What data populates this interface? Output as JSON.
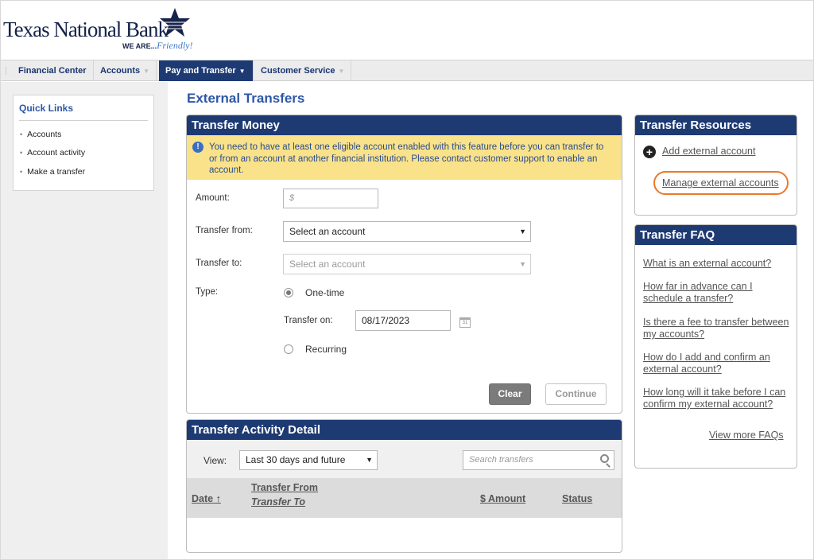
{
  "brand": {
    "name": "Texas National Bank",
    "tagline_part1": "WE ARE...",
    "tagline_part2": "Friendly!"
  },
  "nav": {
    "items": [
      {
        "label": "Financial Center"
      },
      {
        "label": "Accounts"
      },
      {
        "label": "Pay and Transfer"
      },
      {
        "label": "Customer Service"
      }
    ],
    "active": "Pay and Transfer"
  },
  "quick_links": {
    "title": "Quick Links",
    "items": [
      "Accounts",
      "Account activity",
      "Make a transfer"
    ]
  },
  "page": {
    "title": "External Transfers"
  },
  "transfer_money": {
    "title": "Transfer Money",
    "alert": "You need to have at least one eligible account enabled with this feature before you can transfer to or from an account at another financial institution. Please contact customer support to enable an account.",
    "amount_label": "Amount:",
    "amount_placeholder": "$",
    "from_label": "Transfer from:",
    "from_value": "Select an account",
    "to_label": "Transfer to:",
    "to_value": "Select an account",
    "type_label": "Type:",
    "one_time_label": "One-time",
    "transfer_on_label": "Transfer on:",
    "transfer_on_value": "08/17/2023",
    "recurring_label": "Recurring",
    "selected_type": "One-time",
    "clear_label": "Clear",
    "continue_label": "Continue"
  },
  "activity": {
    "title": "Transfer Activity Detail",
    "view_label": "View:",
    "view_value": "Last 30 days and future",
    "search_placeholder": "Search transfers",
    "columns": {
      "date": "Date",
      "date_sort": "↑",
      "from": "Transfer From",
      "to": "Transfer To",
      "amount": "$ Amount",
      "status": "Status"
    },
    "rows": []
  },
  "resources": {
    "title": "Transfer Resources",
    "add_link": "Add external account",
    "manage_link": "Manage external accounts"
  },
  "faq": {
    "title": "Transfer FAQ",
    "items": [
      "What is an external account?",
      "How far in advance can I schedule a transfer?",
      "Is there a fee to transfer between my accounts?",
      "How do I add and confirm an external account?",
      "How long will it take before I can confirm my external account?"
    ],
    "view_more": "View more FAQs"
  },
  "colors": {
    "brand_navy": "#1e3a73",
    "link_blue": "#2d57a6",
    "alert_yellow": "#f9e28a",
    "highlight_orange": "#e87a2a"
  }
}
